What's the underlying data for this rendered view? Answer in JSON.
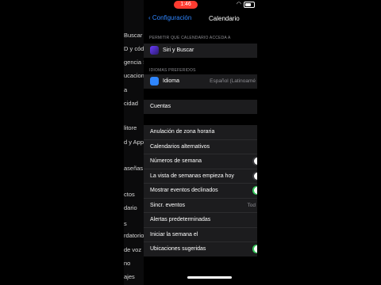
{
  "status_bar": {
    "time": "1:46"
  },
  "nav": {
    "back_label": "Configuración",
    "title": "Calendario"
  },
  "left_column": {
    "items": [
      "Buscar",
      "D y cód",
      "gencia S",
      "ucaciones",
      "a",
      "cidad",
      "litore",
      "d y Apple",
      "aseñas",
      "ctos",
      "dario",
      "s",
      "rdatorios",
      "de voz",
      "no",
      "ajes"
    ]
  },
  "sections": {
    "access_header": "PERMITIR QUE CALENDARIO ACCEDA A",
    "siri_row": {
      "label": "Siri y Buscar",
      "icon": "siri-icon"
    },
    "languages_header": "IDIOMAS PREFERIDOS",
    "language_row": {
      "label": "Idioma",
      "value": "Español (Latinoamé",
      "icon": "globe-icon"
    },
    "accounts_row": {
      "label": "Cuentas"
    },
    "settings_rows": [
      {
        "label": "Anulación de zona horaria"
      },
      {
        "label": "Calendarios alternativos"
      },
      {
        "label": "Números de semana",
        "toggle": "off"
      },
      {
        "label": "La vista de semanas empieza hoy",
        "toggle": "off"
      },
      {
        "label": "Mostrar eventos declinados",
        "toggle": "on"
      },
      {
        "label": "Sincr. eventos",
        "value": "Tod"
      },
      {
        "label": "Alertas predeterminadas"
      },
      {
        "label": "Iniciar la semana el"
      },
      {
        "label": "Ubicaciones sugeridas",
        "toggle": "on"
      }
    ]
  },
  "colors": {
    "accent": "#2f86ff",
    "toggle_on": "#34c759",
    "record_pill": "#ff3b30"
  }
}
